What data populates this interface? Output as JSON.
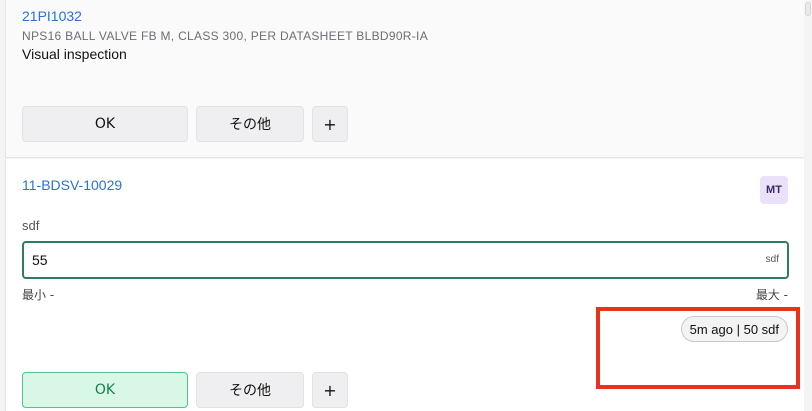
{
  "item1": {
    "tag": "21PI1032",
    "description": "NPS16 BALL VALVE FB M, CLASS 300, PER DATASHEET BLBD90R-IA",
    "task": "Visual inspection",
    "buttons": {
      "ok": "OK",
      "other": "その他",
      "plus": "+"
    }
  },
  "item2": {
    "tag": "11-BDSV-10029",
    "avatar": "MT",
    "field_label": "sdf",
    "input_value": "55",
    "unit": "sdf",
    "min_label": "最小 -",
    "max_label": "最大 -",
    "history": "5m ago | 50 sdf",
    "buttons": {
      "ok": "OK",
      "other": "その他",
      "plus": "+"
    },
    "ok_selected": true
  },
  "colors": {
    "tag_link": "#2f6fd0",
    "input_border": "#2e7d5b",
    "ok_selected_bg": "#d9f7e6",
    "ok_selected_border": "#4fc488",
    "highlight": "#e8321e"
  }
}
